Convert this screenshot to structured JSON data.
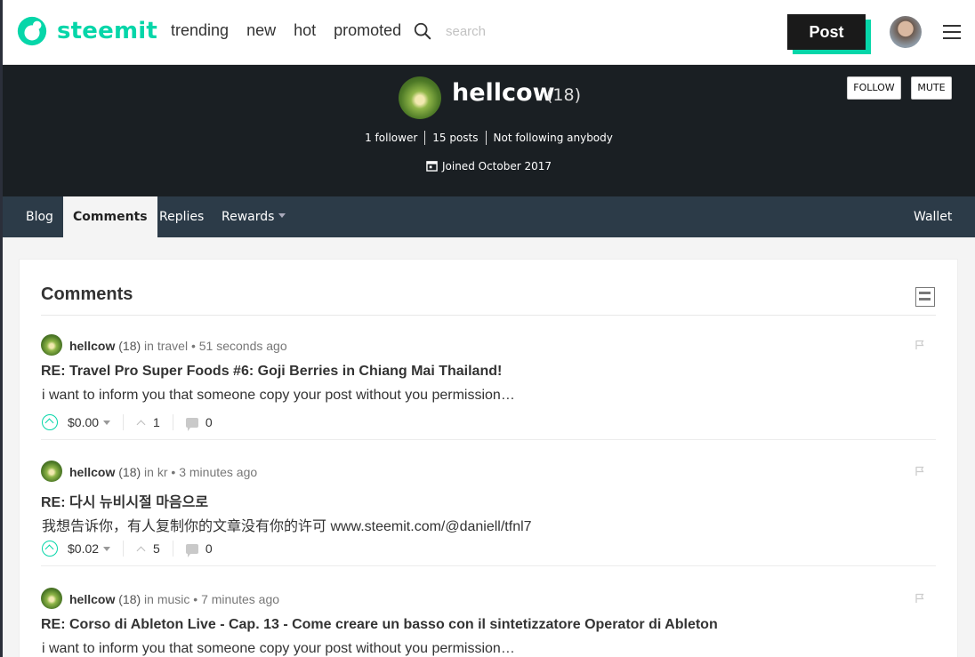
{
  "header": {
    "logo_text": "steemit",
    "nav": [
      "trending",
      "new",
      "hot",
      "promoted"
    ],
    "search_placeholder": "search",
    "post_label": "Post",
    "brand_color": "#06d6a9"
  },
  "profile": {
    "name": "hellcow",
    "reputation": "(18)",
    "followers": "1 follower",
    "posts": "15 posts",
    "following": "Not following anybody",
    "joined": "Joined October 2017",
    "follow_label": "FOLLOW",
    "mute_label": "MUTE"
  },
  "tabs": {
    "blog": "Blog",
    "comments": "Comments",
    "replies": "Replies",
    "rewards": "Rewards",
    "wallet": "Wallet"
  },
  "section": {
    "title": "Comments"
  },
  "comments": [
    {
      "author": "hellcow",
      "rep": "(18)",
      "category_prefix": "in",
      "category": "travel",
      "time": "51 seconds ago",
      "title": "RE: Travel Pro Super Foods #6: Goji Berries in Chiang Mai Thailand!",
      "body": "i want to inform you that someone copy your post without you permission…",
      "payout": "$0.00",
      "votes": "1",
      "replies": "0"
    },
    {
      "author": "hellcow",
      "rep": "(18)",
      "category_prefix": "in",
      "category": "kr",
      "time": "3 minutes ago",
      "title": "RE: 다시 뉴비시절 마음으로",
      "body": "我想告诉你，有人复制你的文章没有你的许可 www.steemit.com/@daniell/tfnl7",
      "payout": "$0.02",
      "votes": "5",
      "replies": "0"
    },
    {
      "author": "hellcow",
      "rep": "(18)",
      "category_prefix": "in",
      "category": "music",
      "time": "7 minutes ago",
      "title": "RE: Corso di Ableton Live - Cap. 13 - Come creare un basso con il sintetizzatore Operator di Ableton",
      "body": "i want to inform you that someone copy your post without you permission…",
      "payout": "",
      "votes": "",
      "replies": ""
    }
  ]
}
